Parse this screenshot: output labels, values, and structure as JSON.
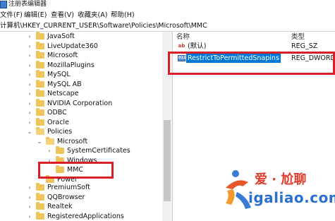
{
  "window": {
    "title": "注册表编辑器"
  },
  "menu": {
    "items": [
      {
        "label": "文件(F)"
      },
      {
        "label": "编辑(E)"
      },
      {
        "label": "查看(V)"
      },
      {
        "label": "收藏夹(A)"
      },
      {
        "label": "帮助(H)"
      }
    ]
  },
  "address": {
    "path": "计算机\\HKEY_CURRENT_USER\\Software\\Policies\\Microsoft\\MMC"
  },
  "tree": {
    "items": [
      {
        "label": "JavaSoft",
        "expander": "›"
      },
      {
        "label": "LiveUpdate360",
        "expander": "›"
      },
      {
        "label": "Microsoft",
        "expander": "›"
      },
      {
        "label": "MozillaPlugins",
        "expander": "›"
      },
      {
        "label": "MySQL",
        "expander": "›"
      },
      {
        "label": "MySQL AB",
        "expander": "›"
      },
      {
        "label": "Netscape",
        "expander": "›"
      },
      {
        "label": "NVIDIA Corporation",
        "expander": "›"
      },
      {
        "label": "ODBC",
        "expander": "›"
      },
      {
        "label": "Oracle",
        "expander": "›"
      },
      {
        "label": "Policies",
        "expander": "⌄"
      },
      {
        "label": "Microsoft",
        "expander": "⌄"
      },
      {
        "label": "SystemCertificates",
        "expander": "›"
      },
      {
        "label": "Windows",
        "expander": "›"
      },
      {
        "label": "MMC",
        "expander": ""
      },
      {
        "label": "Power",
        "expander": ""
      },
      {
        "label": "PremiumSoft",
        "expander": "›"
      },
      {
        "label": "QQBrowser",
        "expander": "›"
      },
      {
        "label": "Realtek",
        "expander": "›"
      },
      {
        "label": "RegisteredApplications",
        "expander": "›"
      }
    ]
  },
  "values": {
    "headers": {
      "name": "名称",
      "type": "类型"
    },
    "rows": [
      {
        "icon": "ab",
        "name": "(默认)",
        "type": "REG_SZ"
      },
      {
        "icon": "011",
        "name": "RestrictToPermittedSnapins",
        "type": "REG_DWORD"
      }
    ]
  },
  "watermark": {
    "title": "爱 · 尬聊",
    "site": "igaliao.com"
  },
  "colors": {
    "highlight": "#0078d7",
    "annotation": "#d61f26",
    "folder": "#eec55a"
  }
}
